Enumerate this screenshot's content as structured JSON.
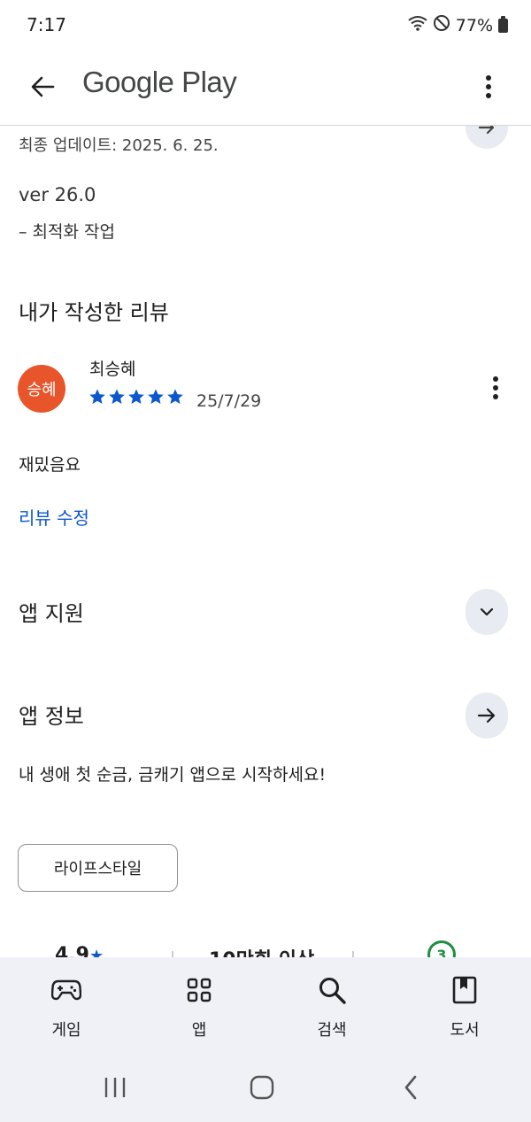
{
  "status_bar": {
    "time": "7:17",
    "battery": "77%"
  },
  "app_bar": {
    "title": "Google Play"
  },
  "update": {
    "date_text": "최종 업데이트: 2025. 6. 25.",
    "version": "ver 26.0",
    "note": "– 최적화 작업"
  },
  "my_review": {
    "title": "내가 작성한 리뷰",
    "avatar_text": "승혜",
    "avatar_color": "#e8552b",
    "reviewer": "최승혜",
    "stars": 5,
    "date": "25/7/29",
    "text": "재밌음요",
    "edit_label": "리뷰 수정"
  },
  "app_support": {
    "title": "앱 지원"
  },
  "app_info": {
    "title": "앱 정보",
    "description": "내 생애 첫 순금, 금캐기 앱으로 시작하세요!",
    "category_chip": "라이프스타일"
  },
  "stats": {
    "rating": "4.9",
    "downloads": "10만회 이상",
    "age_rating": "3"
  },
  "bottom_nav": {
    "items": [
      {
        "label": "게임",
        "icon": "gamepad-icon"
      },
      {
        "label": "앱",
        "icon": "apps-grid-icon"
      },
      {
        "label": "검색",
        "icon": "search-icon"
      },
      {
        "label": "도서",
        "icon": "book-icon"
      }
    ]
  },
  "colors": {
    "accent": "#0b57d0",
    "nav_bg": "#eff1f7"
  }
}
